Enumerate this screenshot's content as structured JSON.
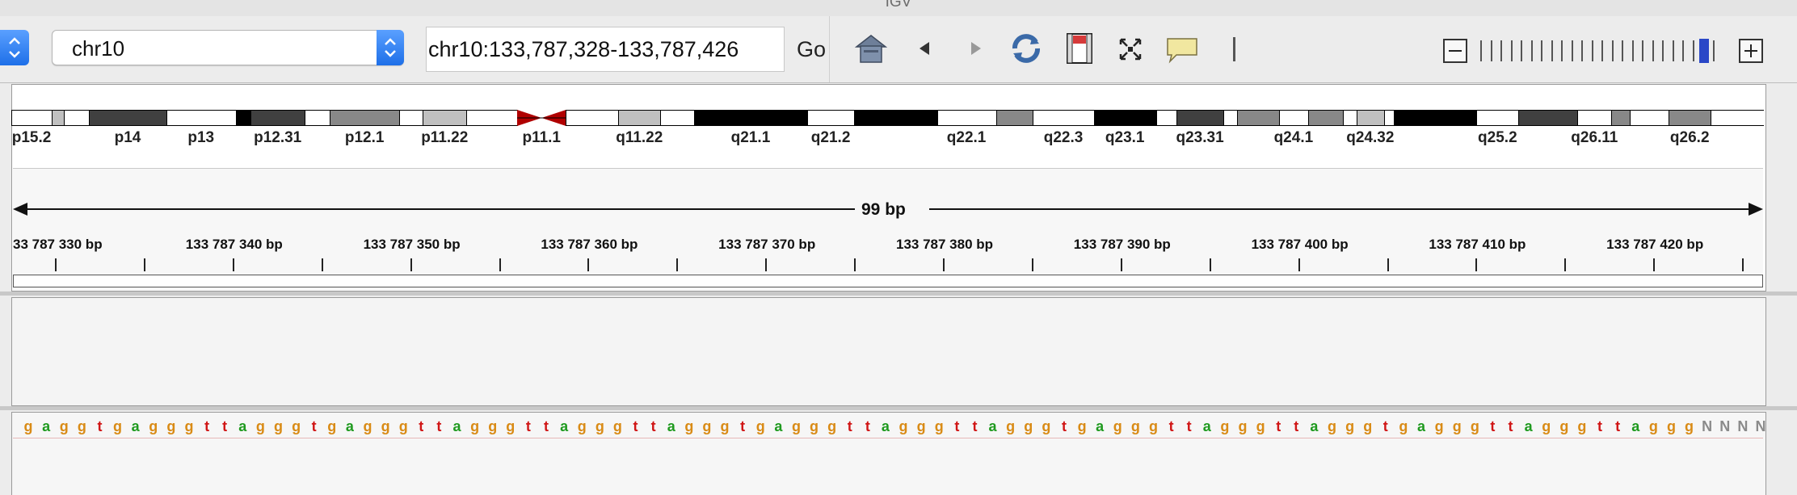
{
  "window": {
    "title": "IGV"
  },
  "toolbar": {
    "chromosome": "chr10",
    "locus": "chr10:133,787,328-133,787,426",
    "go_label": "Go",
    "icons": [
      "home-icon",
      "back-arrow-icon",
      "forward-arrow-icon",
      "refresh-icon",
      "region-of-interest-icon",
      "resize-icon",
      "popup-text-icon",
      "ruler-line-icon"
    ],
    "zoom": {
      "ticks": 24,
      "level": 22
    }
  },
  "ideogram": {
    "bands": [
      {
        "label": "p15.2",
        "shade": "white"
      },
      {
        "label": "",
        "shade": "gpos25"
      },
      {
        "label": "",
        "shade": "white"
      },
      {
        "label": "p14",
        "shade": "gpos75"
      },
      {
        "label": "p13",
        "shade": "white"
      },
      {
        "label": "",
        "shade": "gpos100"
      },
      {
        "label": "p12.31",
        "shade": "gpos75"
      },
      {
        "label": "",
        "shade": "white"
      },
      {
        "label": "p12.1",
        "shade": "gpos50"
      },
      {
        "label": "",
        "shade": "white"
      },
      {
        "label": "p11.22",
        "shade": "gpos25"
      },
      {
        "label": "",
        "shade": "white"
      },
      {
        "label": "p11.1",
        "shade": "acen"
      },
      {
        "label": "",
        "shade": "white"
      },
      {
        "label": "q11.22",
        "shade": "gpos25"
      },
      {
        "label": "",
        "shade": "white"
      },
      {
        "label": "q21.1",
        "shade": "gpos100"
      },
      {
        "label": "q21.2",
        "shade": "white"
      },
      {
        "label": "",
        "shade": "gpos100"
      },
      {
        "label": "q22.1",
        "shade": "white"
      },
      {
        "label": "",
        "shade": "gpos50"
      },
      {
        "label": "q22.3",
        "shade": "white"
      },
      {
        "label": "q23.1",
        "shade": "gpos100"
      },
      {
        "label": "",
        "shade": "white"
      },
      {
        "label": "q23.31",
        "shade": "gpos75"
      },
      {
        "label": "",
        "shade": "white"
      },
      {
        "label": "",
        "shade": "gpos50"
      },
      {
        "label": "q24.1",
        "shade": "white"
      },
      {
        "label": "",
        "shade": "gpos50"
      },
      {
        "label": "",
        "shade": "white"
      },
      {
        "label": "q24.32",
        "shade": "gpos25"
      },
      {
        "label": "",
        "shade": "white"
      },
      {
        "label": "",
        "shade": "gpos100"
      },
      {
        "label": "q25.2",
        "shade": "white"
      },
      {
        "label": "",
        "shade": "gpos75"
      },
      {
        "label": "q26.11",
        "shade": "white"
      },
      {
        "label": "",
        "shade": "gpos50"
      },
      {
        "label": "",
        "shade": "white"
      },
      {
        "label": "q26.2",
        "shade": "gpos50"
      },
      {
        "label": "",
        "shade": "white"
      }
    ]
  },
  "ruler": {
    "span_label": "99 bp",
    "positions": [
      "33 787 330 bp",
      "133 787 340 bp",
      "133 787 350 bp",
      "133 787 360 bp",
      "133 787 370 bp",
      "133 787 380 bp",
      "133 787 390 bp",
      "133 787 400 bp",
      "133 787 410 bp",
      "133 787 420 bp"
    ]
  },
  "sequence": {
    "bases": "gaggtgagggttagggtgagggttagggttagggttagggtgagggttagggttagggtgagggttagggttagggtgagggttagggttagggNNNN"
  },
  "colors": {
    "a": "#1f9a1f",
    "c": "#2a2ad0",
    "g": "#d98b16",
    "t": "#d01616",
    "N": "#8a8a8a",
    "gpos25": "#c0c0c0",
    "gpos50": "#888888",
    "gpos75": "#404040",
    "gpos100": "#000000",
    "acen": "#b00000"
  }
}
